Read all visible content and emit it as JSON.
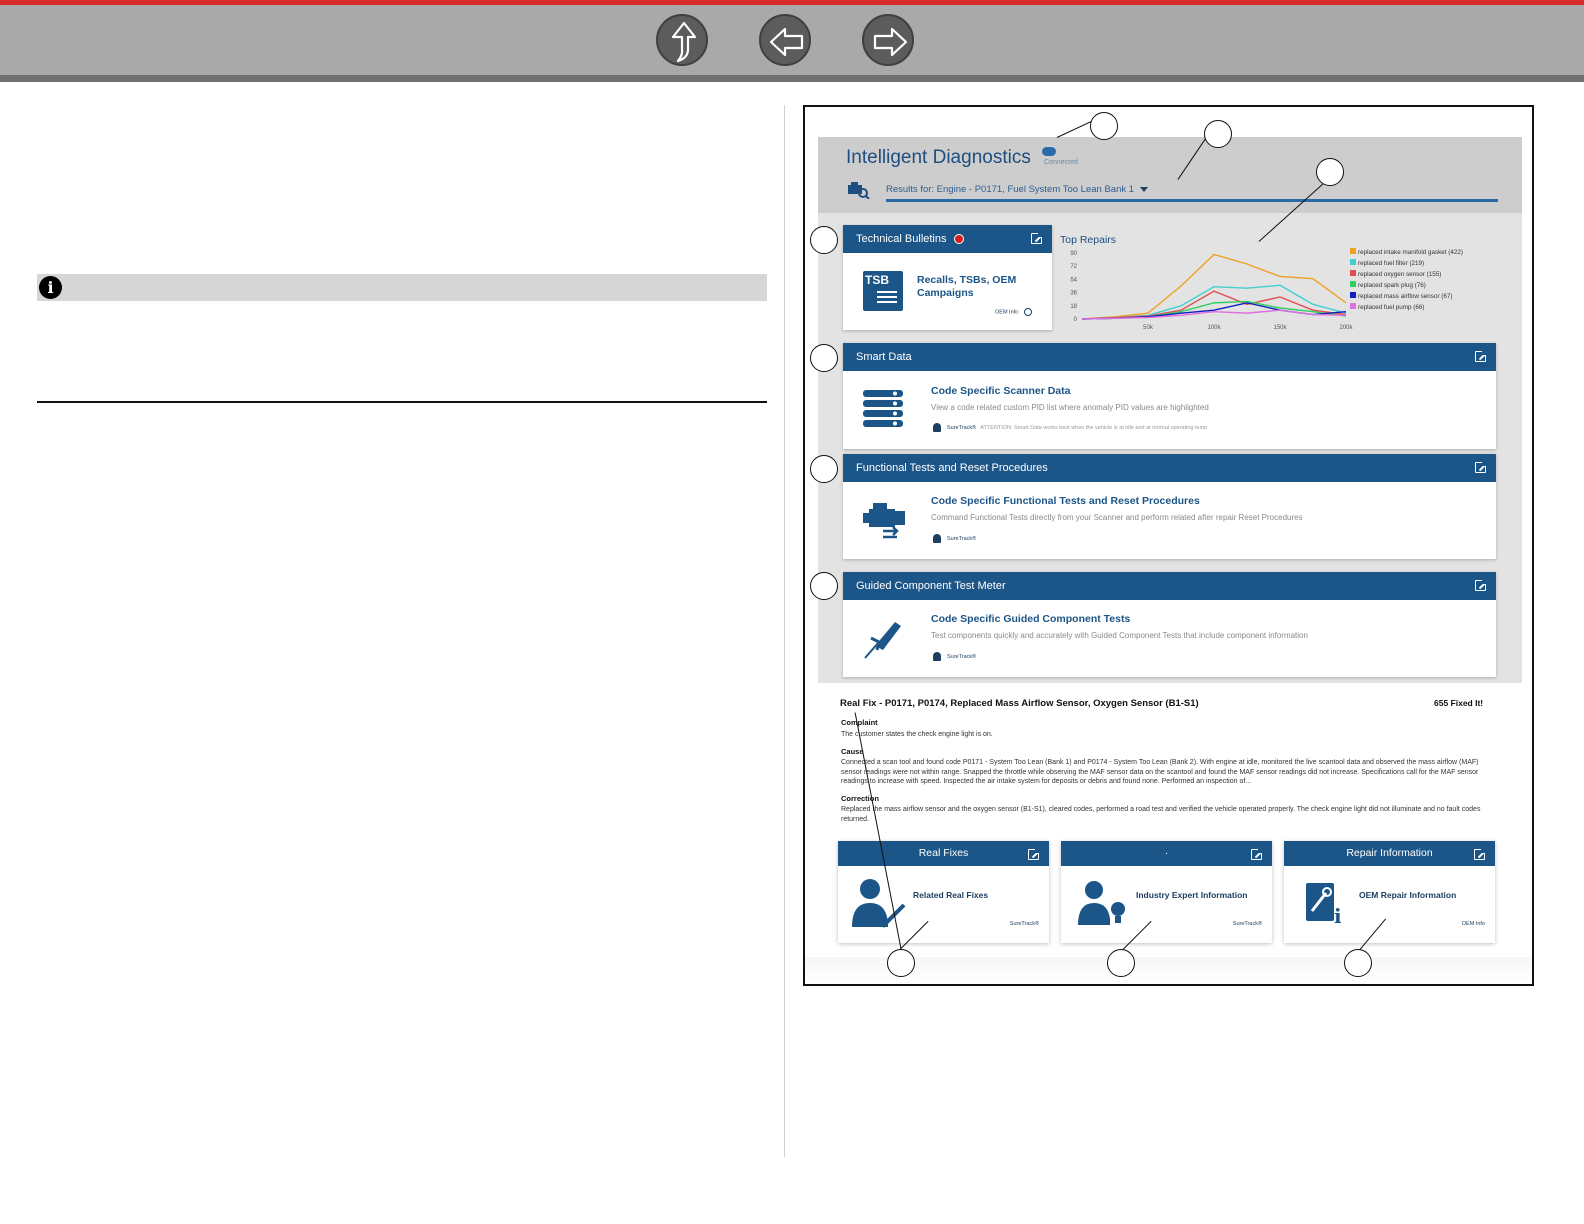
{
  "nav": {
    "up_label": "Up",
    "back_label": "Back",
    "forward_label": "Forward",
    "colors": {
      "bar": "#a9a9a9",
      "accent": "#d42a2a"
    }
  },
  "figure": {
    "header": {
      "title": "Intelligent Diagnostics",
      "status": "Connected",
      "results": "Results for:  Engine - P0171, Fuel System Too Lean Bank 1"
    },
    "technical_bulletins": {
      "heading": "Technical Bulletins",
      "badge_text": "TSB",
      "title_line1": "Recalls, TSBs, OEM",
      "title_line2": "Campaigns",
      "footer": "OEM Info"
    },
    "smart_data": {
      "heading": "Smart Data",
      "title": "Code Specific Scanner Data",
      "description": "View a code related custom PID list where anomaly PID values are highlighted",
      "brand": "SureTrack®",
      "attention": "ATTENTION: Smart Data works best when the vehicle is at idle and at normal operating temp"
    },
    "functional_tests": {
      "heading": "Functional Tests and Reset Procedures",
      "title": "Code Specific Functional Tests and Reset Procedures",
      "description": "Command Functional Tests directly from your Scanner and perform related after repair Reset Procedures",
      "brand": "SureTrack®"
    },
    "guided_component": {
      "heading": "Guided Component Test Meter",
      "title": "Code Specific Guided Component Tests",
      "description": "Test components quickly and accurately with Guided Component Tests that include component information",
      "brand": "SureTrack®"
    },
    "real_fix": {
      "title": "Real Fix - P0171, P0174, Replaced Mass Airflow Sensor, Oxygen Sensor (B1-S1)",
      "count": "655  Fixed It!",
      "complaint_label": "Complaint",
      "complaint_text": "The customer states the check engine light is on.",
      "cause_label": "Cause",
      "cause_text": "Connected a scan tool and found code P0171 - System Too Lean (Bank 1) and P0174 - System Too Lean (Bank 2).  With engine at idle, monitored the live scantool data and observed the mass airflow (MAF) sensor readings were not within range. Snapped the throttle while observing the MAF sensor data on the scantool and found the MAF sensor readings did not increase.  Specifications call for the MAF sensor readings to increase with speed. Inspected the air intake system for deposits or debris and found none. Performed an inspection of...",
      "correction_label": "Correction",
      "correction_text": "Replaced the mass airflow sensor and the oxygen sensor (B1-S1), cleared codes, performed a road test and verified the vehicle operated properly. The check engine light did not illuminate and no fault codes returned."
    },
    "bottom_cards": [
      {
        "heading": "Real Fixes",
        "label": "Related Real Fixes",
        "footer": "SureTrack®"
      },
      {
        "heading": "·",
        "label": "Industry Expert Information",
        "footer": "SureTrack®"
      },
      {
        "heading": "Repair Information",
        "label": "OEM Repair Information",
        "footer": "OEM Info"
      }
    ]
  },
  "chart_data": {
    "type": "line",
    "title": "Top Repairs",
    "x": [
      0,
      25000,
      50000,
      75000,
      100000,
      125000,
      150000,
      175000,
      200000
    ],
    "xticks": [
      "50k",
      "100k",
      "150k",
      "200k"
    ],
    "xtick_values": [
      50000,
      100000,
      150000,
      200000
    ],
    "yticks": [
      0,
      18,
      36,
      54,
      72,
      90
    ],
    "ylim": [
      0,
      90
    ],
    "xlim": [
      0,
      200000
    ],
    "legend_position": "right",
    "series": [
      {
        "name": "replaced intake manifold gasket (422)",
        "color": "#f0a020",
        "values": [
          0,
          3,
          8,
          45,
          88,
          75,
          58,
          55,
          22
        ]
      },
      {
        "name": "replaced fuel filter (219)",
        "color": "#40d0d0",
        "values": [
          0,
          2,
          5,
          18,
          44,
          42,
          46,
          20,
          8
        ]
      },
      {
        "name": "replaced oxygen sensor (155)",
        "color": "#e05050",
        "values": [
          0,
          2,
          4,
          12,
          38,
          20,
          30,
          12,
          6
        ]
      },
      {
        "name": "replaced spark plug (76)",
        "color": "#30d060",
        "values": [
          0,
          1,
          3,
          10,
          22,
          24,
          15,
          10,
          4
        ]
      },
      {
        "name": "replaced mass airflow sensor (67)",
        "color": "#1020c0",
        "values": [
          0,
          1,
          3,
          8,
          12,
          22,
          12,
          6,
          10
        ]
      },
      {
        "name": "replaced fuel pump (66)",
        "color": "#e070e0",
        "values": [
          0,
          1,
          2,
          5,
          10,
          8,
          12,
          6,
          5
        ]
      }
    ]
  }
}
